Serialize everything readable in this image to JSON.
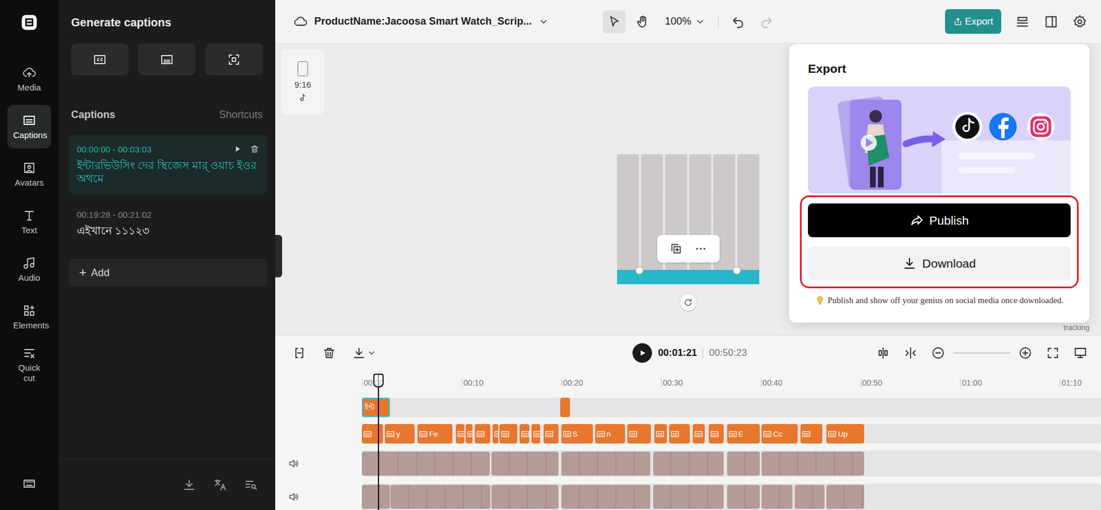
{
  "rail": {
    "items": [
      {
        "label": "Media",
        "selected": false
      },
      {
        "label": "Captions",
        "selected": true
      },
      {
        "label": "Avatars",
        "selected": false
      },
      {
        "label": "Text",
        "selected": false
      },
      {
        "label": "Audio",
        "selected": false
      },
      {
        "label": "Elements",
        "selected": false
      },
      {
        "label": "Quick cut",
        "selected": false
      }
    ]
  },
  "panel": {
    "title": "Generate captions",
    "section": "Captions",
    "shortcuts": "Shortcuts",
    "captions": [
      {
        "time": "00:00:00 - 00:03:03",
        "text": "ইন্টারভিউসিং দের স্থিজেস মার্ ওয়াচ ইওর অথমে",
        "selected": true
      },
      {
        "time": "00:19:28 - 00:21:02",
        "text": "এইখানে ১১১২৩",
        "selected": false
      }
    ],
    "add": {
      "icon": "+",
      "label": "Add"
    }
  },
  "topbar": {
    "title": "ProductName:Jacoosa Smart Watch_Scrip...",
    "zoom": "100%",
    "export": "Export",
    "tools": [
      {
        "selected": true
      },
      {
        "selected": false
      }
    ],
    "undo": {
      "disabled": false
    },
    "redo": {
      "disabled": true
    }
  },
  "canvas": {
    "ratio": "9:16",
    "behind_popup": "tracking"
  },
  "export": {
    "title": "Export",
    "publish": "Publish",
    "download": "Download",
    "tip": "Publish and show off your genius on social media once downloaded.",
    "highlighted": true
  },
  "timeline": {
    "current": "00:01:21",
    "total": "00:50:23",
    "ticks": [
      "00:00",
      "00:10",
      "00:20",
      "00:30",
      "00:40",
      "00:50",
      "01:00",
      "01:10"
    ],
    "tick_step": 10,
    "playhead": 1.6,
    "tracks": [
      {
        "kind": "caption",
        "clips": [
          {
            "start": 0,
            "end": 2.8,
            "label": "ইন্ট",
            "selected": true
          },
          {
            "start": 19.9,
            "end": 20.9,
            "label": "",
            "selected": false
          }
        ]
      },
      {
        "kind": "text",
        "clips": [
          {
            "start": 0,
            "end": 2.1,
            "label": "",
            "selected": false
          },
          {
            "start": 2.3,
            "end": 5.3,
            "label": "y",
            "selected": false
          },
          {
            "start": 5.6,
            "end": 9.1,
            "label": "Fe",
            "selected": false
          },
          {
            "start": 9.4,
            "end": 10.3,
            "label": "",
            "selected": false
          },
          {
            "start": 10.4,
            "end": 11.1,
            "label": "",
            "selected": false
          },
          {
            "start": 11.3,
            "end": 12.9,
            "label": "",
            "selected": false
          },
          {
            "start": 13.1,
            "end": 13.7,
            "label": "",
            "selected": false
          },
          {
            "start": 13.8,
            "end": 15.6,
            "label": "",
            "selected": false
          },
          {
            "start": 15.8,
            "end": 16.8,
            "label": "",
            "selected": false
          },
          {
            "start": 17.0,
            "end": 17.9,
            "label": "",
            "selected": false
          },
          {
            "start": 18.2,
            "end": 19.7,
            "label": "",
            "selected": false
          },
          {
            "start": 20.0,
            "end": 23.2,
            "label": "S",
            "selected": false
          },
          {
            "start": 23.4,
            "end": 26.4,
            "label": "n",
            "selected": false
          },
          {
            "start": 26.6,
            "end": 29.0,
            "label": "",
            "selected": false
          },
          {
            "start": 29.3,
            "end": 30.6,
            "label": "",
            "selected": false
          },
          {
            "start": 30.8,
            "end": 32.9,
            "label": "",
            "selected": false
          },
          {
            "start": 33.2,
            "end": 34.4,
            "label": "",
            "selected": false
          },
          {
            "start": 34.8,
            "end": 36.3,
            "label": "",
            "selected": false
          },
          {
            "start": 36.6,
            "end": 39.9,
            "label": "E",
            "selected": false
          },
          {
            "start": 40.1,
            "end": 43.7,
            "label": "Cc",
            "selected": false
          },
          {
            "start": 44.0,
            "end": 46.2,
            "label": "",
            "selected": false
          },
          {
            "start": 46.6,
            "end": 50.4,
            "label": "Up",
            "selected": false
          }
        ]
      },
      {
        "kind": "video",
        "clips": [
          {
            "start": 0,
            "end": 12.8,
            "label": "",
            "selected": false
          },
          {
            "start": 13.0,
            "end": 19.7,
            "label": "",
            "selected": false
          },
          {
            "start": 20.0,
            "end": 28.9,
            "label": "",
            "selected": false
          },
          {
            "start": 29.2,
            "end": 36.3,
            "label": "",
            "selected": false
          },
          {
            "start": 36.6,
            "end": 39.9,
            "label": "",
            "selected": false
          },
          {
            "start": 40.1,
            "end": 50.4,
            "label": "",
            "selected": false
          }
        ]
      },
      {
        "kind": "video",
        "clips": [
          {
            "start": 0,
            "end": 2.8,
            "label": "",
            "selected": false
          },
          {
            "start": 2.9,
            "end": 12.9,
            "label": "",
            "selected": false
          },
          {
            "start": 13.0,
            "end": 19.7,
            "label": "",
            "selected": false
          },
          {
            "start": 20.0,
            "end": 28.9,
            "label": "",
            "selected": false
          },
          {
            "start": 29.2,
            "end": 36.3,
            "label": "",
            "selected": false
          },
          {
            "start": 36.6,
            "end": 39.9,
            "label": "",
            "selected": false
          },
          {
            "start": 40.1,
            "end": 43.2,
            "label": "",
            "selected": false
          },
          {
            "start": 43.4,
            "end": 46.4,
            "label": "",
            "selected": false
          },
          {
            "start": 46.6,
            "end": 50.4,
            "label": "",
            "selected": false
          }
        ]
      }
    ]
  }
}
